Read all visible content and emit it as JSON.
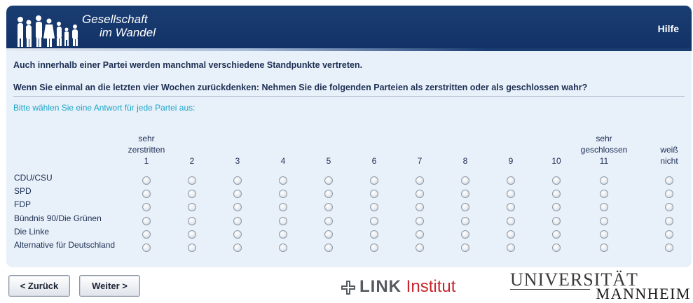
{
  "header": {
    "logo_line1": "Gesellschaft",
    "logo_line2": "im Wandel",
    "help_label": "Hilfe"
  },
  "question": {
    "intro": "Auch innerhalb einer Partei werden manchmal verschiedene Standpunkte vertreten.",
    "text": "Wenn Sie einmal an die letzten vier Wochen zurückdenken: Nehmen Sie die folgenden Parteien als zerstritten oder als geschlossen wahr?",
    "instruction": "Bitte wählen Sie eine Antwort für jede Partei aus:"
  },
  "scale": {
    "columns": [
      {
        "top": "sehr",
        "mid": "zerstritten",
        "num": "1"
      },
      {
        "top": "",
        "mid": "",
        "num": "2"
      },
      {
        "top": "",
        "mid": "",
        "num": "3"
      },
      {
        "top": "",
        "mid": "",
        "num": "4"
      },
      {
        "top": "",
        "mid": "",
        "num": "5"
      },
      {
        "top": "",
        "mid": "",
        "num": "6"
      },
      {
        "top": "",
        "mid": "",
        "num": "7"
      },
      {
        "top": "",
        "mid": "",
        "num": "8"
      },
      {
        "top": "",
        "mid": "",
        "num": "9"
      },
      {
        "top": "",
        "mid": "",
        "num": "10"
      },
      {
        "top": "sehr",
        "mid": "geschlossen",
        "num": "11"
      },
      {
        "top": "",
        "mid": "weiß",
        "num": "nicht"
      }
    ],
    "rows": [
      "CDU/CSU",
      "SPD",
      "FDP",
      "Bündnis 90/Die Grünen",
      "Die Linke",
      "Alternative für Deutschland"
    ]
  },
  "navigation": {
    "back_label": "< Zurück",
    "next_label": "Weiter >"
  },
  "footer": {
    "link_bold": "LINK",
    "link_rest": "Institut",
    "uni_line1": "UNIVERSITÄT",
    "uni_line2": "MANNHEIM"
  },
  "colors": {
    "header": "#123267",
    "panel": "#e8f0fa",
    "instruction": "#1aa6c8",
    "link_red": "#c6262e"
  }
}
